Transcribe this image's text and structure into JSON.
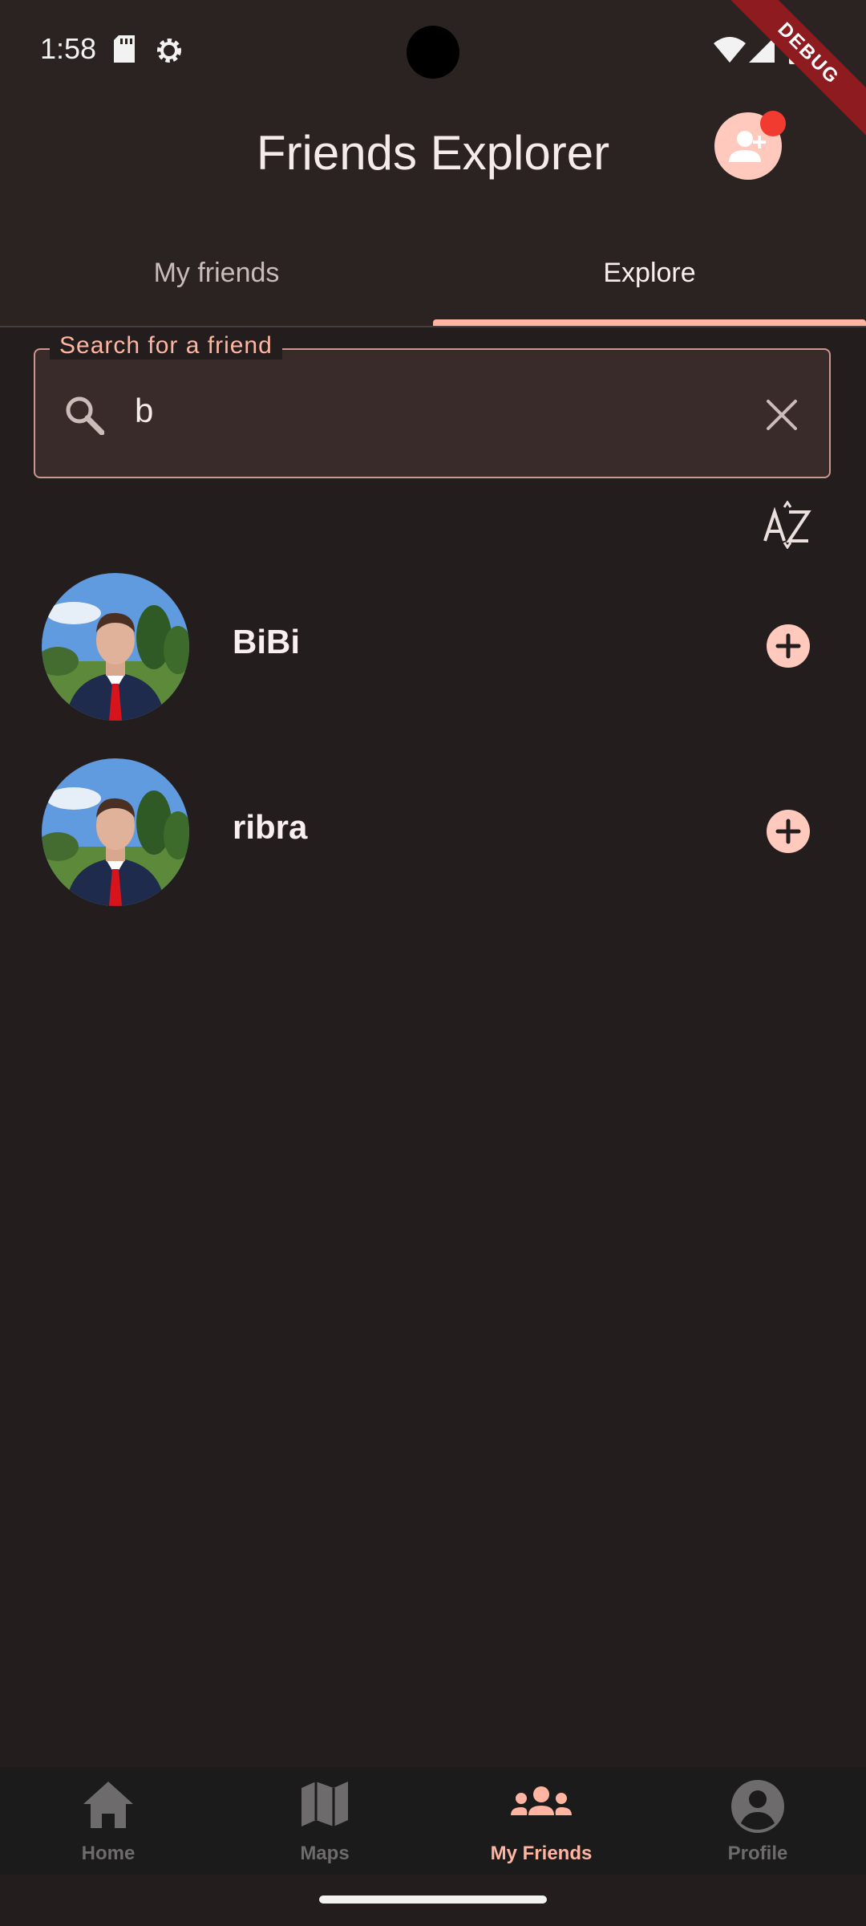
{
  "status_bar": {
    "time": "1:58",
    "icons": [
      "sd-card-icon",
      "settings-gear-icon",
      "wifi-icon",
      "cell-signal-icon",
      "battery-icon"
    ]
  },
  "debug_banner": "DEBUG",
  "app_bar": {
    "title": "Friends Explorer",
    "action_icon": "person-add-icon"
  },
  "tabs": [
    {
      "label": "My friends",
      "selected": false
    },
    {
      "label": "Explore",
      "selected": true
    }
  ],
  "search": {
    "label": "Search for a friend",
    "value": "b",
    "leading_icon": "search-icon",
    "trailing_icon": "close-icon"
  },
  "sort": {
    "icon": "sort-az-icon"
  },
  "friends": [
    {
      "name": "BiBi",
      "action_icon": "add-circle-icon"
    },
    {
      "name": "ribra",
      "action_icon": "add-circle-icon"
    }
  ],
  "bottom_nav": [
    {
      "label": "Home",
      "icon": "home-icon",
      "active": false
    },
    {
      "label": "Maps",
      "icon": "map-icon",
      "active": false
    },
    {
      "label": "My Friends",
      "icon": "group-icon",
      "active": true
    },
    {
      "label": "Profile",
      "icon": "account-circle-icon",
      "active": false
    }
  ],
  "colors": {
    "background": "#241d1d",
    "surface": "#2b2322",
    "accent": "#ffb5a1",
    "accent_container": "#ffcabd",
    "notification": "#f23b30",
    "debug": "#8e1b1f",
    "nav_inactive": "#6d6b6b"
  }
}
